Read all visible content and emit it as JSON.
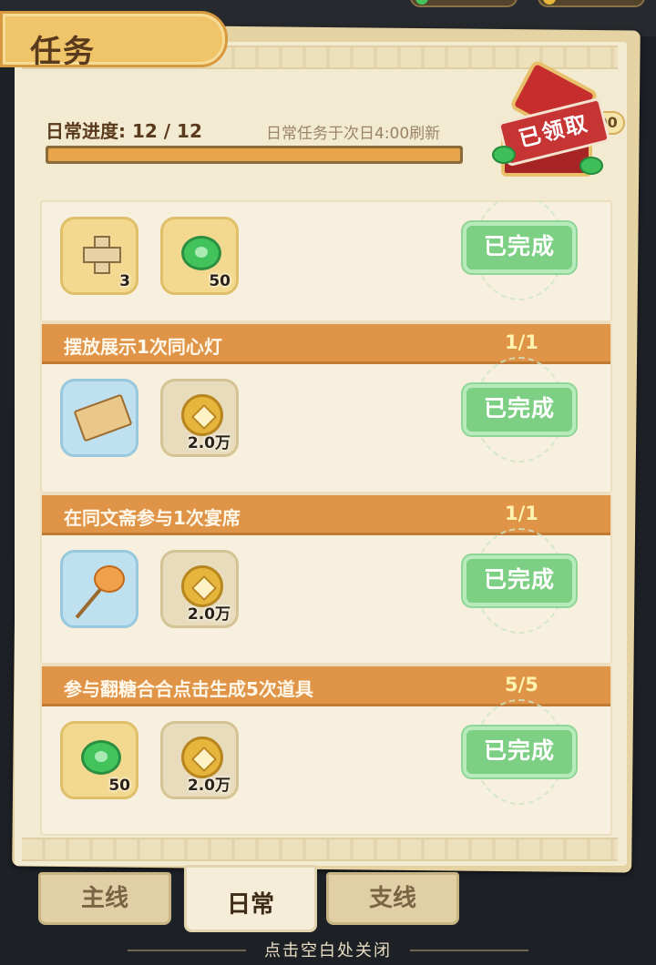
{
  "panel": {
    "title": "任务",
    "progress_label": "日常进度: 12 / 12",
    "progress_fraction": 1.0,
    "refresh_hint": "日常任务于次日4:00刷新",
    "chest_status": "已领取",
    "chest_reward": "200"
  },
  "tasks": [
    {
      "title": "",
      "count": "",
      "rewards": [
        {
          "icon": "puzzle-blocks-icon",
          "qty": "3"
        },
        {
          "icon": "jade-icon",
          "qty": "50"
        }
      ],
      "status": "已完成"
    },
    {
      "title": "摆放展示1次同心灯",
      "count": "1/1",
      "rewards": [
        {
          "icon": "scroll-icon",
          "qty": ""
        },
        {
          "icon": "copper-coin-icon",
          "qty": "2.0万"
        }
      ],
      "status": "已完成"
    },
    {
      "title": "在同文斋参与1次宴席",
      "count": "1/1",
      "rewards": [
        {
          "icon": "sugar-figure-icon",
          "qty": ""
        },
        {
          "icon": "copper-coin-icon",
          "qty": "2.0万"
        }
      ],
      "status": "已完成"
    },
    {
      "title": "参与翻糖合合点击生成5次道具",
      "count": "5/5",
      "rewards": [
        {
          "icon": "jade-icon",
          "qty": "50"
        },
        {
          "icon": "copper-coin-icon",
          "qty": "2.0万"
        }
      ],
      "status": "已完成"
    }
  ],
  "tabs": [
    {
      "label": "主线",
      "active": false
    },
    {
      "label": "日常",
      "active": true
    },
    {
      "label": "支线",
      "active": false
    }
  ],
  "footer": {
    "close_hint": "点击空白处关闭"
  },
  "colors": {
    "header_orange": "#df9447",
    "done_green": "#7ccf83",
    "progress_fill": "#e8a54b"
  }
}
